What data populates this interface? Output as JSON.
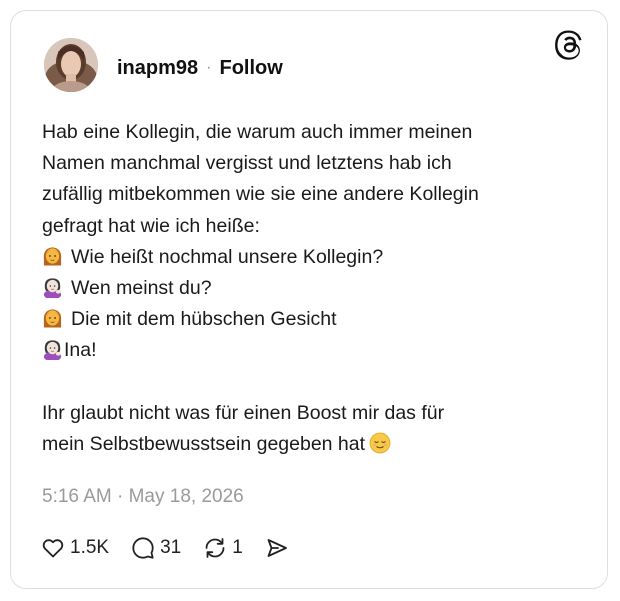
{
  "post": {
    "username": "inapm98",
    "separator": "·",
    "follow_label": "Follow",
    "lines": [
      "Hab eine Kollegin, die warum auch immer meinen",
      "Namen manchmal vergisst und letztens hab ich",
      "zufällig mitbekommen wie sie eine andere Kollegin",
      "gefragt hat wie ich heiße:"
    ],
    "dialogue": [
      {
        "emoji": "woman-emoji",
        "text": "Wie heißt nochmal unsere Kollegin?"
      },
      {
        "emoji": "woman-tipping-hand-emoji",
        "text": "Wen meinst du?"
      },
      {
        "emoji": "woman-emoji",
        "text": "Die mit dem hübschen Gesicht"
      },
      {
        "emoji": "woman-tipping-hand-emoji",
        "text": "Ina!"
      }
    ],
    "closing_lines": [
      "Ihr glaubt nicht was für einen Boost mir das für",
      "mein Selbstbewusstsein gegeben hat"
    ],
    "closing_emoji": "relieved-face-emoji",
    "timestamp": "5:16 AM · May 18, 2026"
  },
  "actions": {
    "likes": "1.5K",
    "replies": "31",
    "reposts": "1"
  },
  "icons": {
    "logo": "threads-logo-icon",
    "like": "heart-icon",
    "reply": "comment-icon",
    "repost": "repost-icon",
    "share": "send-icon"
  },
  "colors": {
    "text": "#111111",
    "muted": "#9a9a9a",
    "border": "#dedede"
  }
}
